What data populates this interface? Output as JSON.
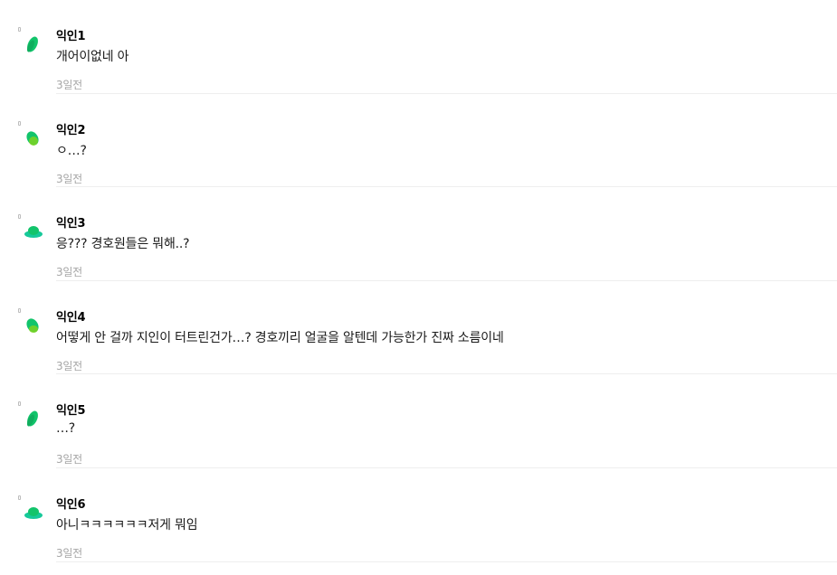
{
  "comments": [
    {
      "author": "익인1",
      "text": "개어이없네 아",
      "time": "3일전",
      "avatar_icon": "green-leaf-icon",
      "avatar_color": "#12c46b"
    },
    {
      "author": "익인2",
      "text": "ㅇ…?",
      "time": "3일전",
      "avatar_icon": "green-leaf-icon",
      "avatar_color": "#12c46b"
    },
    {
      "author": "익인3",
      "text": "응??? 경호원들은 뭐해..?",
      "time": "3일전",
      "avatar_icon": "green-hat-icon",
      "avatar_color": "#17c99a"
    },
    {
      "author": "익인4",
      "text": "어떻게 안 걸까 지인이 터트린건가…? 경호끼리 얼굴을 알텐데 가능한가 진짜 소름이네",
      "time": "3일전",
      "avatar_icon": "green-leaf-icon",
      "avatar_color": "#12c46b"
    },
    {
      "author": "익인5",
      "text": "…?",
      "time": "3일전",
      "avatar_icon": "green-leaf-icon",
      "avatar_color": "#12c46b"
    },
    {
      "author": "익인6",
      "text": "아니ㅋㅋㅋㅋㅋㅋ저게 뭐임",
      "time": "3일전",
      "avatar_icon": "green-hat-icon",
      "avatar_color": "#17c99a"
    }
  ]
}
